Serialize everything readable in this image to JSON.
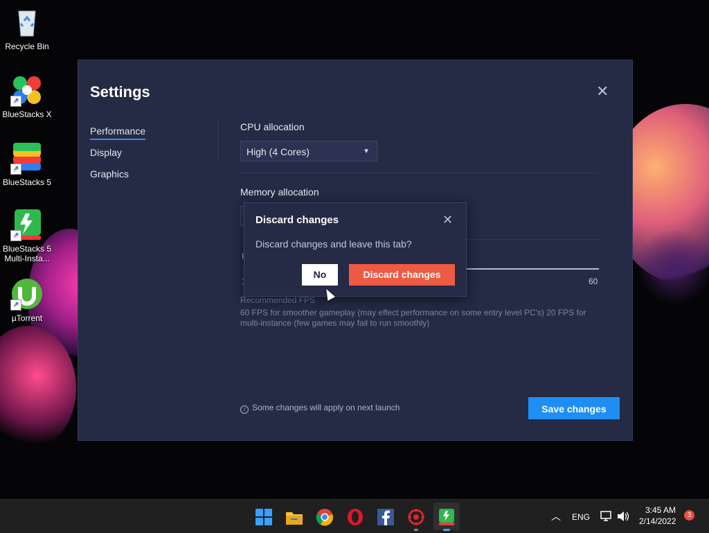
{
  "desktop": {
    "icons": [
      {
        "label": "Recycle Bin"
      },
      {
        "label": "BlueStacks X"
      },
      {
        "label": "BlueStacks 5"
      },
      {
        "label": "BlueStacks 5 Multi-Insta..."
      },
      {
        "label": "µTorrent"
      }
    ]
  },
  "settings": {
    "title": "Settings",
    "nav": [
      "Performance",
      "Display",
      "Graphics"
    ],
    "cpu_label": "CPU allocation",
    "cpu_value": "High (4 Cores)",
    "memory_label": "Memory allocation",
    "fps_fragment": "F",
    "slider_min": "1",
    "slider_max": "60",
    "recommended_title": "Recommended FPS",
    "recommended_text": "60 FPS for smoother gameplay (may effect performance on some entry level PC's) 20 FPS for multi-instance (few games may fail to run smoothly)",
    "note": "Some changes will apply on next launch",
    "save_label": "Save changes"
  },
  "dialog": {
    "title": "Discard changes",
    "message": "Discard changes and leave this tab?",
    "no_label": "No",
    "discard_label": "Discard changes"
  },
  "taskbar": {
    "apps": [
      "start-icon",
      "file-explorer-icon",
      "chrome-icon",
      "opera-icon",
      "facebook-icon",
      "game-app-icon",
      "bluestacks-multi-instance-icon"
    ],
    "language": "ENG",
    "time": "3:45 AM",
    "date": "2/14/2022",
    "notifications": "3"
  },
  "colors": {
    "window_bg": "#252a45",
    "accent": "#1e8ef5",
    "danger": "#ee5a43"
  }
}
